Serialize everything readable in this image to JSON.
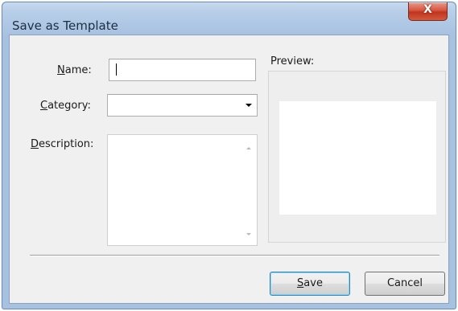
{
  "window": {
    "title": "Save as Template",
    "close_glyph": "X"
  },
  "form": {
    "name_label": "Name:",
    "name_value": "",
    "category_label": "Category:",
    "category_value": "",
    "description_label": "Description:",
    "description_value": ""
  },
  "preview": {
    "label": "Preview:"
  },
  "buttons": {
    "save_label": "Save",
    "cancel_label": "Cancel"
  },
  "icons": {
    "close": "close-icon",
    "combo": "chevron-down-icon",
    "scroll_up": "scroll-up-arrow-icon",
    "scroll_down": "scroll-down-arrow-icon"
  },
  "colors": {
    "titlebar": "#b9cfe8",
    "close_button": "#c7402c",
    "dialog_background": "#f0f0f0",
    "default_button_border": "#3c7fb1"
  }
}
